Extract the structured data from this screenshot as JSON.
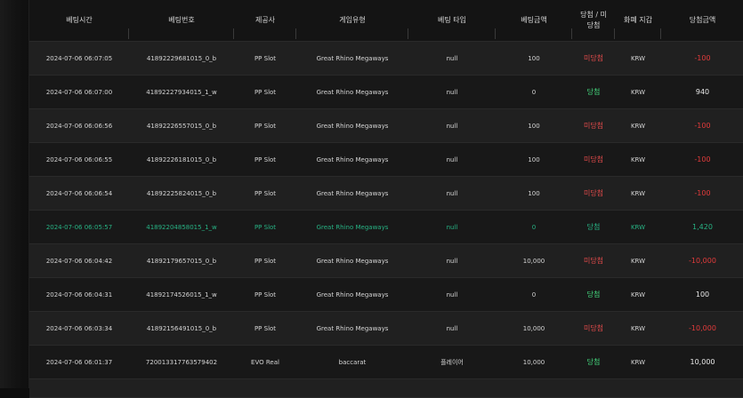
{
  "headers": [
    "베팅시간",
    "베팅번호",
    "제공사",
    "게임유형",
    "베팅 타입",
    "베팅금액",
    "당첨 / 미당첨",
    "화폐 지갑",
    "당첨금액"
  ],
  "rows": [
    {
      "time": "2024-07-06 06:07:05",
      "id": "41892229681015_0_b",
      "provider": "PP Slot",
      "game": "Great Rhino Megaways",
      "type": "null",
      "bet": "100",
      "result": "미당첨",
      "currency": "KRW",
      "payout": "-100",
      "highlight": false
    },
    {
      "time": "2024-07-06 06:07:00",
      "id": "41892227934015_1_w",
      "provider": "PP Slot",
      "game": "Great Rhino Megaways",
      "type": "null",
      "bet": "0",
      "result": "당첨",
      "currency": "KRW",
      "payout": "940",
      "highlight": false
    },
    {
      "time": "2024-07-06 06:06:56",
      "id": "41892226557015_0_b",
      "provider": "PP Slot",
      "game": "Great Rhino Megaways",
      "type": "null",
      "bet": "100",
      "result": "미당첨",
      "currency": "KRW",
      "payout": "-100",
      "highlight": false
    },
    {
      "time": "2024-07-06 06:06:55",
      "id": "41892226181015_0_b",
      "provider": "PP Slot",
      "game": "Great Rhino Megaways",
      "type": "null",
      "bet": "100",
      "result": "미당첨",
      "currency": "KRW",
      "payout": "-100",
      "highlight": false
    },
    {
      "time": "2024-07-06 06:06:54",
      "id": "41892225824015_0_b",
      "provider": "PP Slot",
      "game": "Great Rhino Megaways",
      "type": "null",
      "bet": "100",
      "result": "미당첨",
      "currency": "KRW",
      "payout": "-100",
      "highlight": false
    },
    {
      "time": "2024-07-06 06:05:57",
      "id": "41892204858015_1_w",
      "provider": "PP Slot",
      "game": "Great Rhino Megaways",
      "type": "null",
      "bet": "0",
      "result": "당첨",
      "currency": "KRW",
      "payout": "1,420",
      "highlight": true
    },
    {
      "time": "2024-07-06 06:04:42",
      "id": "41892179657015_0_b",
      "provider": "PP Slot",
      "game": "Great Rhino Megaways",
      "type": "null",
      "bet": "10,000",
      "result": "미당첨",
      "currency": "KRW",
      "payout": "-10,000",
      "highlight": false
    },
    {
      "time": "2024-07-06 06:04:31",
      "id": "41892174526015_1_w",
      "provider": "PP Slot",
      "game": "Great Rhino Megaways",
      "type": "null",
      "bet": "0",
      "result": "당첨",
      "currency": "KRW",
      "payout": "100",
      "highlight": false
    },
    {
      "time": "2024-07-06 06:03:34",
      "id": "41892156491015_0_b",
      "provider": "PP Slot",
      "game": "Great Rhino Megaways",
      "type": "null",
      "bet": "10,000",
      "result": "미당첨",
      "currency": "KRW",
      "payout": "-10,000",
      "highlight": false
    },
    {
      "time": "2024-07-06 06:01:37",
      "id": "720013317763579402",
      "provider": "EVO Real",
      "game": "baccarat",
      "type": "플레이어",
      "bet": "10,000",
      "result": "당첨",
      "currency": "KRW",
      "payout": "10,000",
      "highlight": false
    }
  ],
  "colors": {
    "win": "#43d67c",
    "lose": "#e04a4a",
    "highlight": "#27b384",
    "negative": "#e23b3b"
  }
}
